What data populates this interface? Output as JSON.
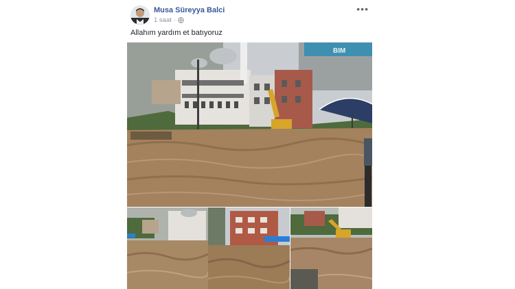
{
  "post": {
    "author": "Musa Süreyya Balci",
    "time": "1 saat",
    "separator": "·",
    "privacy_icon": "globe-icon",
    "more_icon": "more-options-icon",
    "more_label": "•••",
    "text": "Allahım yardım et batıyoruz"
  },
  "photos": {
    "main_alt": "Flooded street with mosque and excavator",
    "sign_text": "BIM",
    "thumbnails": [
      {
        "alt": "Flooded street near mosque"
      },
      {
        "alt": "Muddy water flowing past building"
      },
      {
        "alt": "Excavator in flood debris"
      }
    ]
  },
  "colors": {
    "author_link": "#385898",
    "meta_text": "#90949c",
    "body_text": "#1d2129",
    "mud": "#a4825e",
    "sky": "#c8ccd0"
  }
}
